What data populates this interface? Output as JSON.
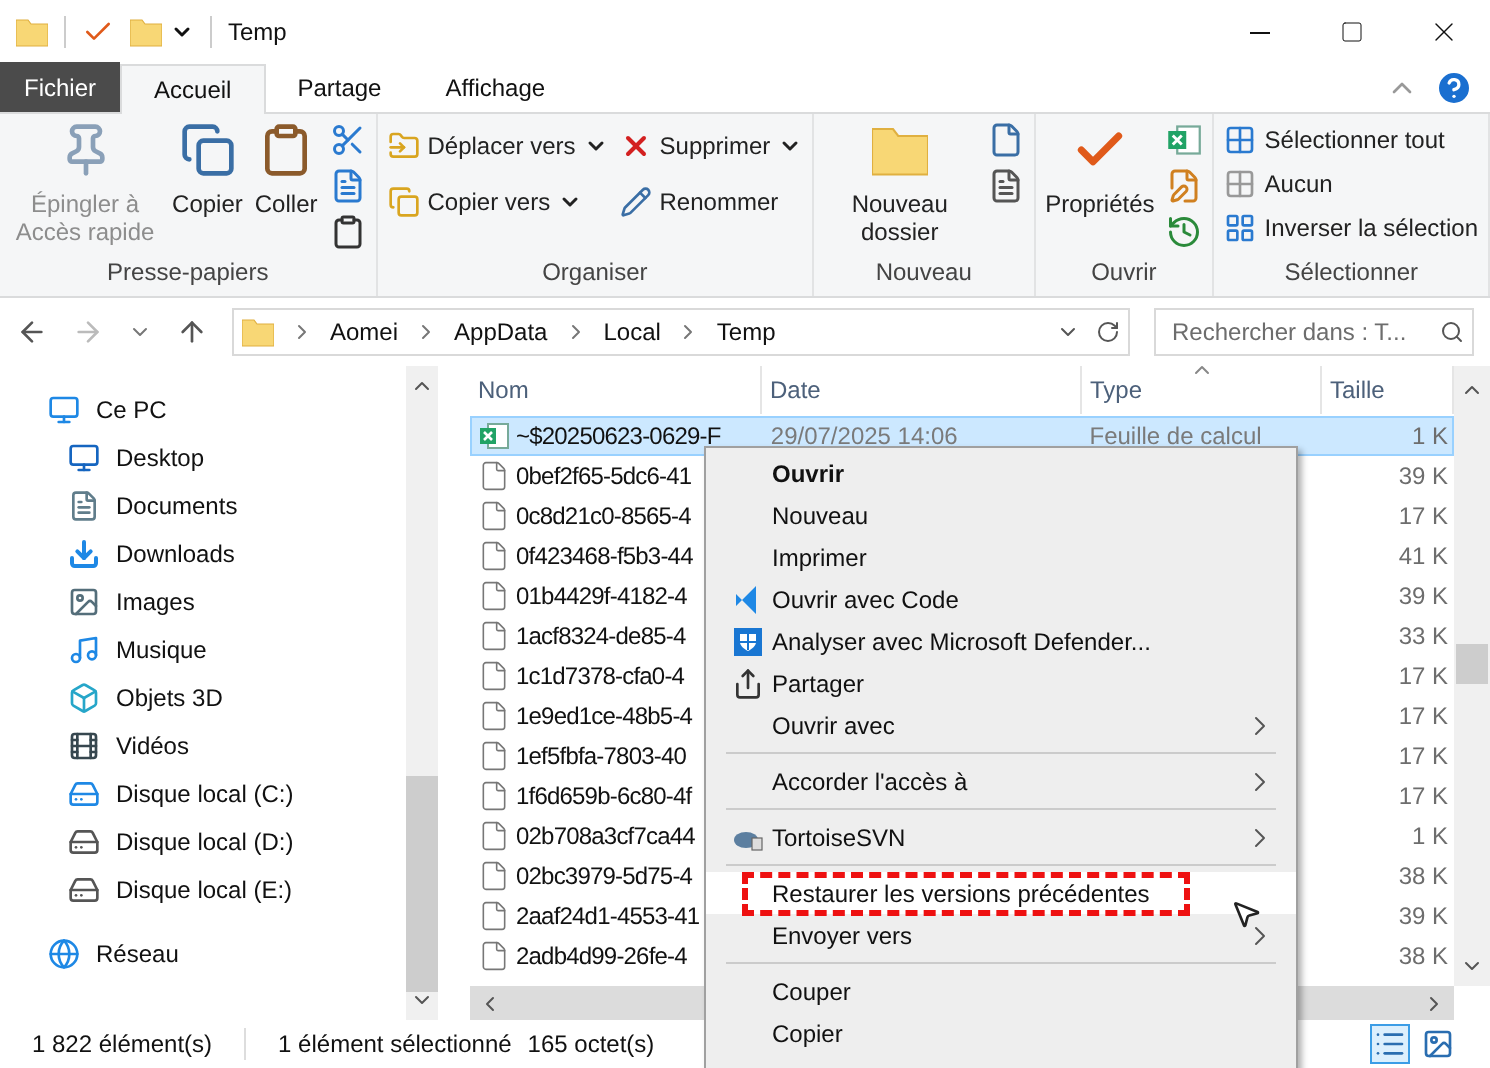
{
  "window": {
    "title": "Temp"
  },
  "ribbon_tabs": [
    {
      "label": "Fichier",
      "kind": "file",
      "selected": false
    },
    {
      "label": "Accueil",
      "kind": "tab",
      "selected": true
    },
    {
      "label": "Partage",
      "kind": "tab",
      "selected": false
    },
    {
      "label": "Affichage",
      "kind": "tab",
      "selected": false
    }
  ],
  "ribbon_groups": [
    {
      "label": "Presse-papiers",
      "items": [
        {
          "kind": "big",
          "label": "Épingler à Accès rapide",
          "disabled": true
        },
        {
          "kind": "big",
          "label": "Copier",
          "disabled": false
        },
        {
          "kind": "big",
          "label": "Coller",
          "disabled": false
        },
        {
          "kind": "icons"
        }
      ]
    },
    {
      "label": "Organiser",
      "items": [
        {
          "kind": "stack",
          "rows": [
            {
              "label": "Déplacer vers",
              "dropdown": true
            },
            {
              "label": "Copier vers",
              "dropdown": true
            }
          ]
        },
        {
          "kind": "stack",
          "rows": [
            {
              "label": "Supprimer",
              "dropdown": true
            },
            {
              "label": "Renommer",
              "dropdown": false
            }
          ]
        }
      ]
    },
    {
      "label": "Nouveau",
      "items": [
        {
          "kind": "big",
          "label": "Nouveau dossier",
          "disabled": false
        },
        {
          "kind": "icons"
        }
      ]
    },
    {
      "label": "Ouvrir",
      "items": [
        {
          "kind": "big",
          "label": "Propriétés",
          "disabled": false
        },
        {
          "kind": "icons"
        }
      ]
    },
    {
      "label": "Sélectionner",
      "items": [
        {
          "kind": "stack",
          "rows": [
            {
              "label": "Sélectionner tout",
              "dropdown": false
            },
            {
              "label": "Aucun",
              "dropdown": false
            },
            {
              "label": "Inverser la sélection",
              "dropdown": false
            }
          ]
        }
      ]
    }
  ],
  "address_bar": {
    "path": [
      "Aomei",
      "AppData",
      "Local",
      "Temp"
    ],
    "search_placeholder": "Rechercher dans : T..."
  },
  "sidebar": {
    "items": [
      {
        "label": "Ce PC",
        "children": [
          {
            "label": "Desktop"
          },
          {
            "label": "Documents"
          },
          {
            "label": "Downloads"
          },
          {
            "label": "Images"
          },
          {
            "label": "Musique"
          },
          {
            "label": "Objets 3D"
          },
          {
            "label": "Vidéos"
          },
          {
            "label": "Disque local (C:)"
          },
          {
            "label": "Disque local (D:)"
          },
          {
            "label": "Disque local (E:)"
          }
        ]
      },
      {
        "label": "Réseau"
      }
    ]
  },
  "table": {
    "columns": [
      {
        "label": "Nom",
        "sorted": false
      },
      {
        "label": "Date",
        "sorted": false
      },
      {
        "label": "Type",
        "sorted": true
      },
      {
        "label": "Taille",
        "sorted": false
      }
    ],
    "rows": [
      {
        "kind": "spreadsheet",
        "name": "~$20250623-0629-F",
        "date": "29/07/2025 14:06",
        "type": "Feuille de calcul",
        "size": "1 K",
        "selected": true
      },
      {
        "kind": "file",
        "name": "0bef2f65-5dc6-41",
        "size": "39 K",
        "selected": false
      },
      {
        "kind": "file",
        "name": "0c8d21c0-8565-4",
        "size": "17 K",
        "selected": false
      },
      {
        "kind": "file",
        "name": "0f423468-f5b3-44",
        "size": "41 K",
        "selected": false
      },
      {
        "kind": "file",
        "name": "01b4429f-4182-4",
        "size": "39 K",
        "selected": false
      },
      {
        "kind": "file",
        "name": "1acf8324-de85-4",
        "size": "33 K",
        "selected": false
      },
      {
        "kind": "file",
        "name": "1c1d7378-cfa0-4",
        "size": "17 K",
        "selected": false
      },
      {
        "kind": "file",
        "name": "1e9ed1ce-48b5-4",
        "size": "17 K",
        "selected": false
      },
      {
        "kind": "file",
        "name": "1ef5fbfa-7803-40",
        "size": "17 K",
        "selected": false
      },
      {
        "kind": "file",
        "name": "1f6d659b-6c80-4f",
        "size": "17 K",
        "selected": false
      },
      {
        "kind": "file",
        "name": "02b708a3cf7ca44",
        "size": "1 K",
        "selected": false
      },
      {
        "kind": "file",
        "name": "02bc3979-5d75-4",
        "size": "38 K",
        "selected": false
      },
      {
        "kind": "file",
        "name": "2aaf24d1-4553-41",
        "size": "39 K",
        "selected": false
      },
      {
        "kind": "file",
        "name": "2adb4d99-26fe-4",
        "size": "38 K",
        "selected": false
      }
    ]
  },
  "context_menu": {
    "items": [
      {
        "kind": "item",
        "label": "Ouvrir",
        "bold": true,
        "submenu": false,
        "selected": false,
        "marked": false
      },
      {
        "kind": "item",
        "label": "Nouveau",
        "bold": false,
        "submenu": false,
        "selected": false,
        "marked": false
      },
      {
        "kind": "item",
        "label": "Imprimer",
        "bold": false,
        "submenu": false,
        "selected": false,
        "marked": false
      },
      {
        "kind": "item",
        "label": "Ouvrir avec Code",
        "bold": false,
        "submenu": false,
        "selected": false,
        "marked": false
      },
      {
        "kind": "item",
        "label": "Analyser avec Microsoft Defender...",
        "bold": false,
        "submenu": false,
        "selected": false,
        "marked": false
      },
      {
        "kind": "item",
        "label": "Partager",
        "bold": false,
        "submenu": false,
        "selected": false,
        "marked": false
      },
      {
        "kind": "item",
        "label": "Ouvrir avec",
        "bold": false,
        "submenu": true,
        "selected": false,
        "marked": false
      },
      {
        "kind": "separator"
      },
      {
        "kind": "item",
        "label": "Accorder l'accès à",
        "bold": false,
        "submenu": true,
        "selected": false,
        "marked": false
      },
      {
        "kind": "separator"
      },
      {
        "kind": "item",
        "label": "TortoiseSVN",
        "bold": false,
        "submenu": true,
        "selected": false,
        "marked": false
      },
      {
        "kind": "separator"
      },
      {
        "kind": "item",
        "label": "Restaurer les versions précédentes",
        "bold": false,
        "submenu": false,
        "selected": true,
        "marked": true
      },
      {
        "kind": "item",
        "label": "Envoyer vers",
        "bold": false,
        "submenu": true,
        "selected": false,
        "marked": false
      },
      {
        "kind": "separator"
      },
      {
        "kind": "item",
        "label": "Couper",
        "bold": false,
        "submenu": false,
        "selected": false,
        "marked": false
      },
      {
        "kind": "item",
        "label": "Copier",
        "bold": false,
        "submenu": false,
        "selected": false,
        "marked": false
      }
    ]
  },
  "status_bar": {
    "count": "1 822 élément(s)",
    "selection": "1 élément sélectionné",
    "size": "165 octet(s)",
    "views": [
      {
        "kind": "details",
        "selected": true
      },
      {
        "kind": "tiles",
        "selected": false
      }
    ]
  }
}
